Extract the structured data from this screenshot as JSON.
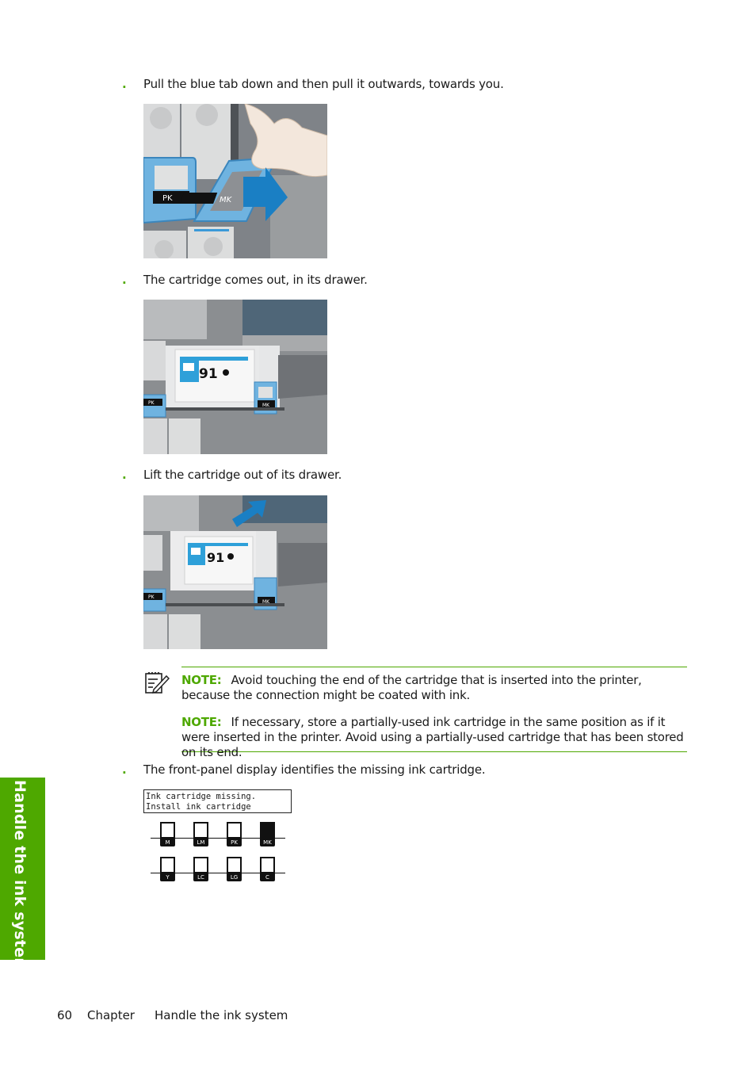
{
  "steps": [
    {
      "bullet": ".",
      "text": "Pull the blue tab down and then pull it outwards, towards you."
    },
    {
      "bullet": ".",
      "text": "The cartridge comes out, in its drawer."
    },
    {
      "bullet": ".",
      "text": "Lift the cartridge out of its drawer."
    },
    {
      "bullet": ".",
      "text": "The front-panel display identifies the missing ink cartridge."
    }
  ],
  "figures": {
    "fig1": {
      "labels": [
        "PK",
        "MK"
      ]
    },
    "fig2": {
      "labels": [
        "PK",
        "MK"
      ],
      "cartridge_number": "91"
    },
    "fig3": {
      "labels": [
        "PK",
        "MK"
      ],
      "cartridge_number": "91"
    }
  },
  "notes": [
    {
      "label": "NOTE:",
      "text": "Avoid touching the end of the cartridge that is inserted into the printer, because the connection might be coated with ink."
    },
    {
      "label": "NOTE:",
      "text": "If necessary, store a partially-used ink cartridge in the same position as if it were inserted in the printer. Avoid using a partially-used cartridge that has been stored on its end."
    }
  ],
  "front_panel": {
    "lines": [
      "Ink cartridge missing.",
      "Install ink cartridge"
    ],
    "cartridges": [
      {
        "label": "M",
        "missing": false
      },
      {
        "label": "LM",
        "missing": false
      },
      {
        "label": "PK",
        "missing": false
      },
      {
        "label": "MK",
        "missing": true
      },
      {
        "label": "Y",
        "missing": false
      },
      {
        "label": "LC",
        "missing": false
      },
      {
        "label": "LG",
        "missing": false
      },
      {
        "label": "C",
        "missing": false
      }
    ]
  },
  "side_tab": "Handle the ink system",
  "footer": {
    "page": "60",
    "chapter": "Chapter",
    "title": "Handle the ink system"
  },
  "colors": {
    "accent": "#4ea800",
    "tab_blue": "#6fb3e0",
    "arrow_blue": "#1a7fc4"
  }
}
